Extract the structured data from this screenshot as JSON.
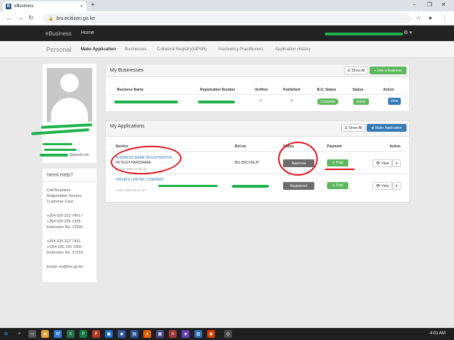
{
  "browser": {
    "tab_title": "eBusiness",
    "tab_close": "×",
    "new_tab": "+",
    "url": "brs.ecitizen.go.ke",
    "back": "←",
    "forward": "→",
    "reload": "↻"
  },
  "nav": {
    "brand": "eBusiness",
    "home": "Home"
  },
  "subnav": {
    "personal": "Personal",
    "links": [
      "Make Application",
      "Businesses",
      "Collateral Registry(MPSR)",
      "Insolvency Practitioners",
      "Application History"
    ]
  },
  "profile": {
    "email_suffix": "@gmail.com"
  },
  "help": {
    "title": "Need Help?",
    "lines": [
      "Call Business",
      "Registration Service",
      "Customer Care",
      "+254 020 222 7461 /",
      "+254 020 225 1355",
      "Extension No. 37591",
      "+254 020 222 7461",
      "/+254 020 225 1355",
      "Extension No. 37110",
      "Email: eo@brs.go.ke"
    ]
  },
  "my_businesses": {
    "title": "My Businesses",
    "show_all": "Show All",
    "link_business": "+ Link a Business",
    "headers": [
      "Business Name",
      "Registration Number",
      "Verified",
      "Published",
      "B.O. Status",
      "Status",
      "Action"
    ],
    "row": {
      "bo_status": "Complete",
      "status": "Active",
      "action": "View",
      "verified": "✓",
      "published": "✓"
    }
  },
  "my_applications": {
    "title": "My Applications",
    "show_all": "Show All",
    "make_application": "Make Application",
    "headers": [
      "Service",
      "Ref no.",
      "Status",
      "Payment",
      "Action"
    ],
    "rows": [
      {
        "service": "BUSINESS NAME REGISTRATION",
        "name": "PETESH HARDWARE",
        "date": "04 Oct 2022 12:36 pm",
        "ref": "BN-2MCX5EJP",
        "status": "Approval",
        "payment": "Paid",
        "action": "View"
      },
      {
        "service": "PRIVATE LIMITED COMPANY",
        "name": "",
        "date": "9 Dec 2020 10:27 pm",
        "ref": "",
        "status": "Registered",
        "payment": "Paid",
        "action": "View"
      }
    ]
  },
  "taskbar": {
    "clock": "4:01 AM"
  },
  "colors": {
    "green": "#5cb85c",
    "blue": "#337ab7",
    "dark_nav": "#222222",
    "annotation_red": "#e0101a",
    "scribble_green": "#1db24a"
  }
}
